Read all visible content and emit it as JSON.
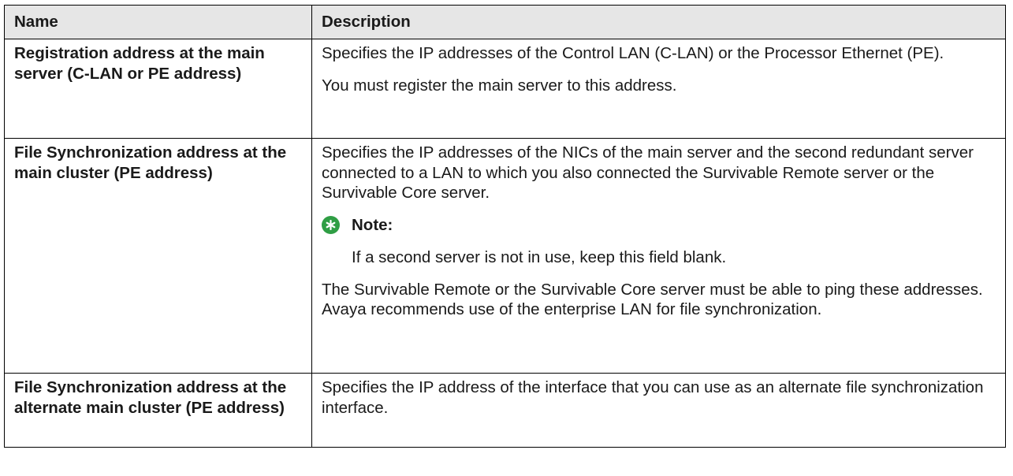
{
  "table": {
    "headers": {
      "name": "Name",
      "description": "Description"
    },
    "rows": [
      {
        "name": "Registration address at the main server (C-LAN or PE address)",
        "paragraphs": [
          "Specifies the IP addresses of the Control LAN (C-LAN) or the Processor Ethernet (PE).",
          "You must register the main server to this address."
        ]
      },
      {
        "name": "File Synchronization address at the main cluster (PE address)",
        "paragraphs": [
          "Specifies the IP addresses of the NICs of the main server and the second redundant server connected to a LAN to which you also connected the Survivable Remote server or the Survivable Core server."
        ],
        "note": {
          "label": "Note:",
          "text": "If a second server is not in use, keep this field blank."
        },
        "after_note": "The Survivable Remote or the Survivable Core server must be able to ping these addresses. Avaya recommends use of the enterprise LAN for file synchronization."
      },
      {
        "name": "File Synchronization address at the alternate main cluster (PE address)",
        "paragraphs": [
          "Specifies the IP address of the interface that you can use as an alternate file synchronization interface."
        ]
      }
    ]
  },
  "icons": {
    "note_icon": "asterisk-note-icon",
    "note_icon_color": "#2f9e44"
  }
}
